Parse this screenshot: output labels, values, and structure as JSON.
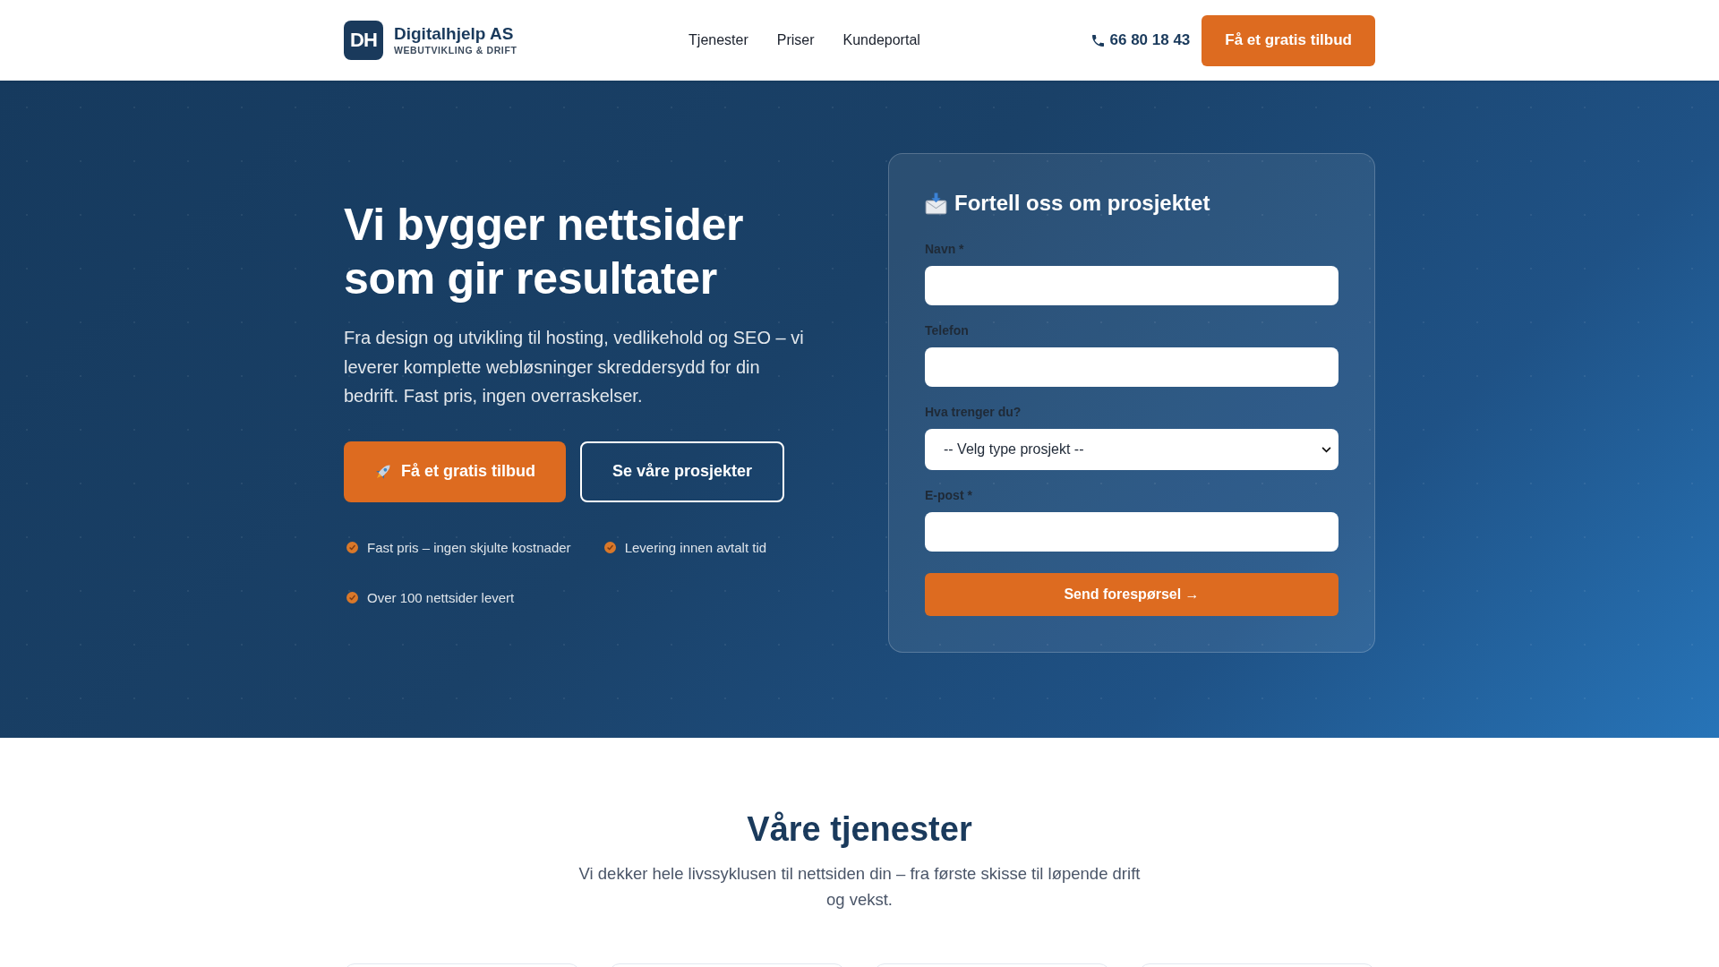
{
  "header": {
    "logo": {
      "mark": "DH",
      "name": "Digitalhjelp AS",
      "tagline": "WEBUTVIKLING & DRIFT"
    },
    "nav": [
      {
        "label": "Tjenester"
      },
      {
        "label": "Priser"
      },
      {
        "label": "Kundeportal"
      }
    ],
    "phone": "66 80 18 43",
    "cta": "Få et gratis tilbud"
  },
  "hero": {
    "title": "Vi bygger nettsider som gir resultater",
    "intro": "Fra design og utvikling til hosting, vedlikehold og SEO – vi leverer komplette webløsninger skreddersydd for din bedrift. Fast pris, ingen overraskelser.",
    "buttons": [
      {
        "kind": "primary",
        "label": "Få et gratis tilbud"
      },
      {
        "kind": "outline",
        "label": "Se våre prosjekter"
      }
    ],
    "highlights": [
      "Fast pris – ingen skjulte kostnader",
      "Levering innen avtalt tid",
      "Over 100 nettsider levert"
    ]
  },
  "form": {
    "title": "Fortell oss om prosjektet",
    "fields": [
      {
        "kind": "text",
        "label": "Navn *"
      },
      {
        "kind": "text",
        "label": "Telefon"
      },
      {
        "kind": "select",
        "label": "Hva trenger du?",
        "value": "-- Velg type prosjekt --"
      },
      {
        "kind": "text",
        "label": "E-post *"
      }
    ],
    "submit": "Send forespørsel →"
  },
  "services": {
    "title": "Våre tjenester",
    "intro": "Vi dekker hele livssyklusen til nettsiden din – fra første skisse til løpende drift og vekst."
  }
}
